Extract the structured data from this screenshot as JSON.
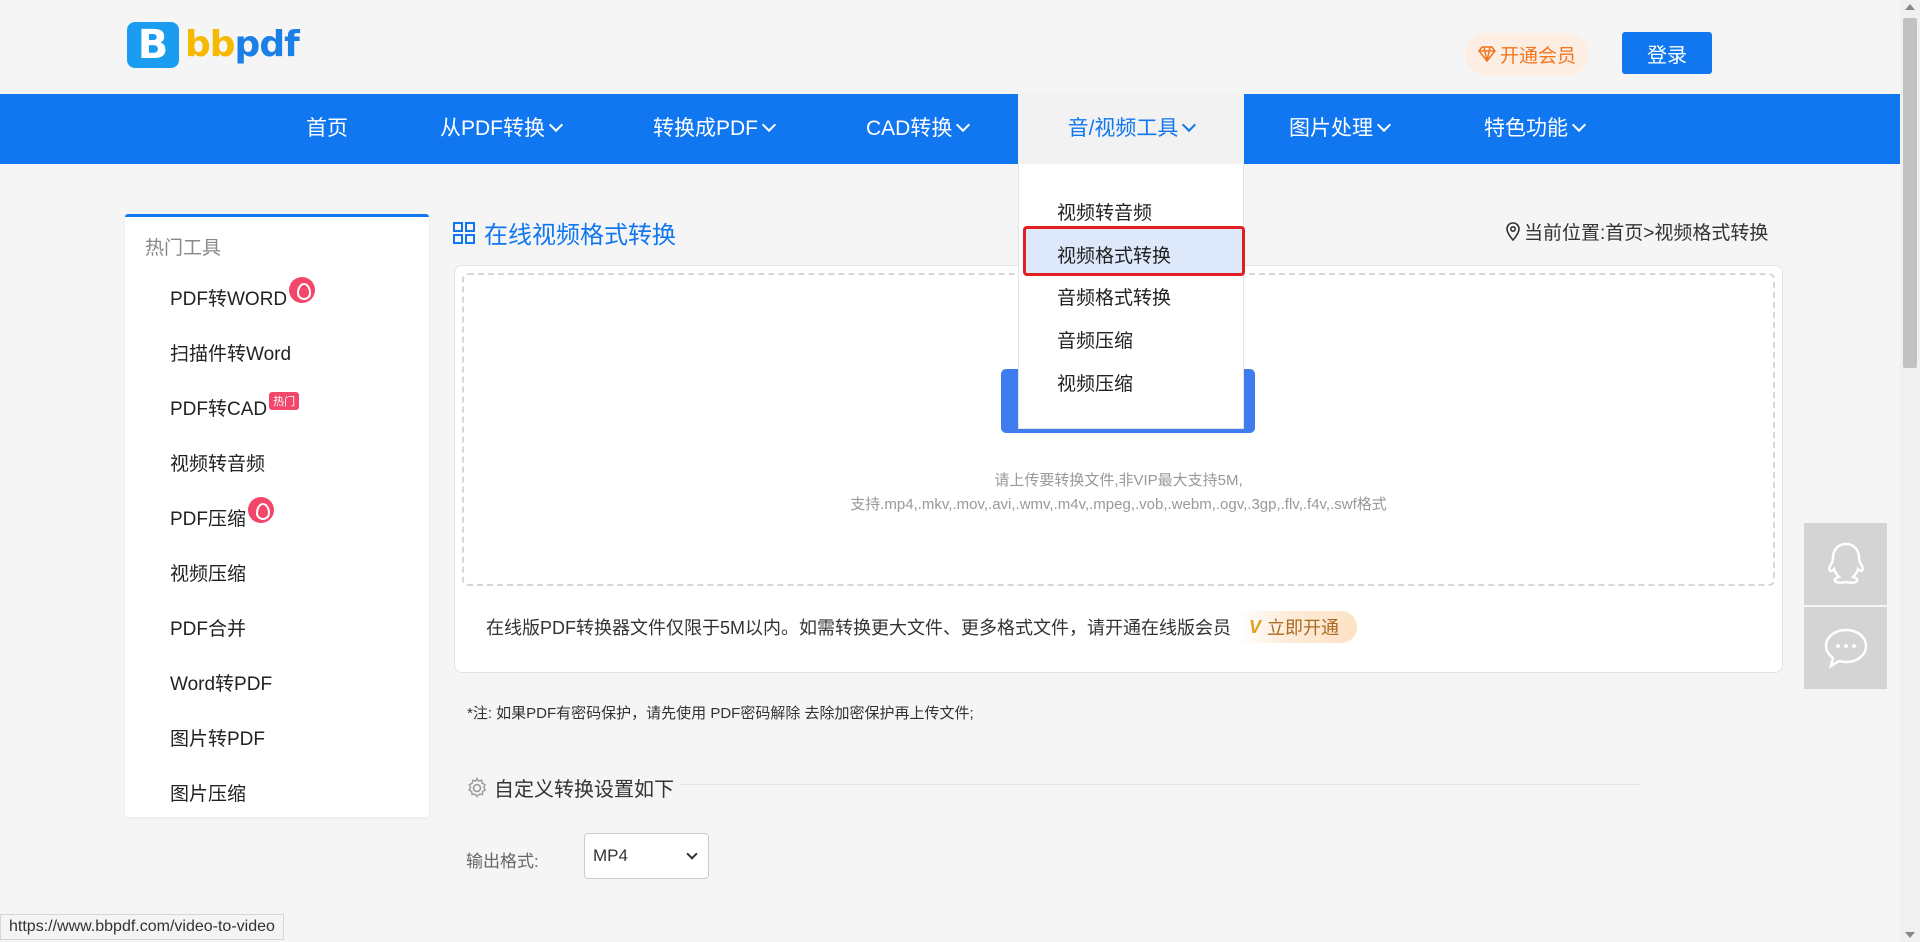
{
  "header": {
    "logo_letter": "B",
    "logo_text_part1": "bb",
    "logo_text_part2": "pdf",
    "vip_label": "开通会员",
    "login_label": "登录"
  },
  "nav": {
    "items": [
      {
        "label": "首页"
      },
      {
        "label": "从PDF转换"
      },
      {
        "label": "转换成PDF"
      },
      {
        "label": "CAD转换"
      },
      {
        "label": "音/视频工具"
      },
      {
        "label": "图片处理"
      },
      {
        "label": "特色功能"
      }
    ],
    "active_index": 4
  },
  "dropdown": {
    "items": [
      "视频转音频",
      "视频格式转换",
      "音频格式转换",
      "音频压缩",
      "视频压缩"
    ],
    "highlighted_index": 1
  },
  "sidebar": {
    "title": "热门工具",
    "items": [
      {
        "label": "PDF转WORD",
        "badge": "fire"
      },
      {
        "label": "扫描件转Word"
      },
      {
        "label": "PDF转CAD",
        "badge": "热门"
      },
      {
        "label": "视频转音频"
      },
      {
        "label": "PDF压缩",
        "badge": "fire"
      },
      {
        "label": "视频压缩"
      },
      {
        "label": "PDF合并"
      },
      {
        "label": "Word转PDF"
      },
      {
        "label": "图片转PDF"
      },
      {
        "label": "图片压缩"
      }
    ]
  },
  "main": {
    "title": "在线视频格式转换",
    "breadcrumb": "当前位置:首页>视频格式转换",
    "upload_hint_line1": "请上传要转换文件,非VIP最大支持5M,",
    "upload_hint_line2": "支持.mp4,.mkv,.mov,.avi,.wmv,.m4v,.mpeg,.vob,.webm,.ogv,.3gp,.flv,.f4v,.swf格式",
    "notice_text": "在线版PDF转换器文件仅限于5M以内。如需转换更大文件、更多格式文件，请开通在线版会员",
    "open_now_label": "立即开通",
    "vip_mark": "V",
    "note_prefix": "*注:  如果PDF有密码保护，请先使用 ",
    "note_link": "PDF密码解除",
    "note_suffix": " 去除加密保护再上传文件;",
    "settings_title": "自定义转换设置如下",
    "output_format_label": "输出格式:",
    "output_format_value": "MP4"
  },
  "statusbar": {
    "url": "https://www.bbpdf.com/video-to-video"
  },
  "colors": {
    "brand_blue": "#1177f0",
    "vip_orange": "#f2761e",
    "highlight_red": "#e02020",
    "badge_pink": "#f2476a"
  }
}
